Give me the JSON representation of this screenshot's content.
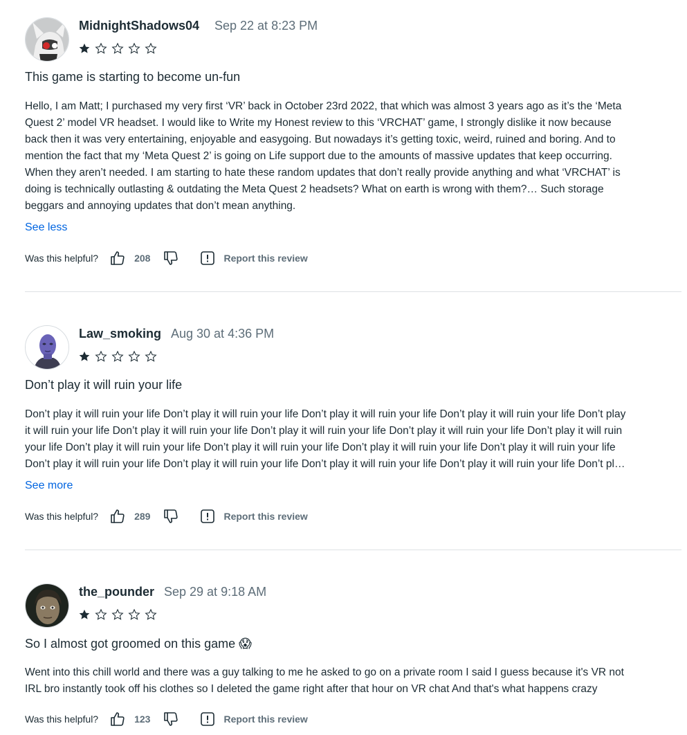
{
  "reviews": [
    {
      "author": "MidnightShadows04",
      "date": "Sep 22 at 8:23 PM",
      "rating": 1,
      "title": "This game is starting to become un-fun",
      "body_lines": [
        "Hello, I am Matt; I purchased my very first ‘VR’ back in October 23rd 2022, that which was almost 3 years ago as it’s the ‘Meta",
        "Quest 2’ model VR headset. I would like to Write my Honest review to this ‘VRCHAT’ game, I strongly dislike it now because",
        "back then it was very entertaining, enjoyable and easygoing. But nowadays it’s getting toxic, weird, ruined and boring. And to",
        "mention the fact that my ‘Meta Quest 2’ is going on Life support due to the amounts of massive updates that keep occurring.",
        "When they aren’t needed. I am starting to hate these random updates that don’t really provide anything and what ‘VRCHAT’ is",
        "doing is technically outlasting & outdating the Meta Quest 2 headsets? What on earth is wrong with them?… Such storage",
        "beggars and annoying updates that don’t mean anything."
      ],
      "toggle_label": "See less",
      "helpful_label": "Was this helpful?",
      "helpful_count": "208",
      "report_label": "Report this review"
    },
    {
      "author": "Law_smoking",
      "date": "Aug 30 at 4:36 PM",
      "rating": 1,
      "title": "Don’t play it will ruin your life",
      "body_lines": [
        "Don’t play it will ruin your life Don’t play it will ruin your life Don’t play it will ruin your life Don’t play it will ruin your life Don’t play",
        "it will ruin your life Don’t play it will ruin your life Don’t play it will ruin your life Don’t play it will ruin your life Don’t play it will ruin",
        "your life Don’t play it will ruin your life Don’t play it will ruin your life Don’t play it will ruin your life Don’t play it will ruin your life",
        "Don’t play it will ruin your life Don’t play it will ruin your life Don’t play it will ruin your life Don’t play it will ruin your life Don’t pl…"
      ],
      "toggle_label": "See more",
      "helpful_label": "Was this helpful?",
      "helpful_count": "289",
      "report_label": "Report this review"
    },
    {
      "author": "the_pounder",
      "date": "Sep 29 at 9:18 AM",
      "rating": 1,
      "title": "So I almost got groomed on this game 😱",
      "body_lines": [
        "Went into this chill world and there was a guy talking to me he asked to go on a private room I said I guess because it's VR not",
        "IRL bro instantly took off his clothes so I deleted the game right after that hour on VR chat And that's what happens crazy"
      ],
      "helpful_label": "Was this helpful?",
      "helpful_count": "123",
      "report_label": "Report this review"
    }
  ],
  "colors": {
    "text": "#1c2b33",
    "muted": "#5d6d78",
    "link": "#0064e0",
    "divider": "#dde1e4"
  }
}
